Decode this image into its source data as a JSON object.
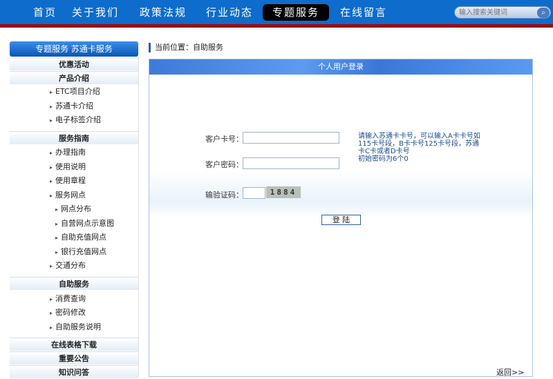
{
  "nav": [
    "首页",
    "关于我们",
    "政策法规",
    "行业动态",
    "专题服务",
    "在线留言"
  ],
  "search": {
    "placeholder": "输入搜索关键词",
    "button": "⌕"
  },
  "sidebar": {
    "title": "专题服务 苏通卡服务",
    "sections": [
      "优惠活动",
      "产品介绍",
      "服务指南",
      "自助服务",
      "在线表格下载",
      "重要公告",
      "知识问答"
    ],
    "product_items": [
      "ETC项目介绍",
      "苏通卡介绍",
      "电子标签介绍"
    ],
    "guide_items": [
      "办理指南",
      "使用说明",
      "使用章程",
      "服务网点"
    ],
    "outlet_items": [
      "网点分布",
      "自营网点示意图",
      "自助充值网点",
      "银行充值网点"
    ],
    "guide_last": "交通分布",
    "self_items": [
      "消费查询",
      "密码修改",
      "自助服务说明"
    ]
  },
  "breadcrumb": "当前位置：自助服务",
  "panel": {
    "title": "个人用户登录",
    "card_label": "客户卡号：",
    "password_label": "客户密码：",
    "captcha_label": "输验证码：",
    "captcha": "1884",
    "hint": "请输入苏通卡卡号，可以输入A卡卡号如115卡号段，B卡卡号125卡号段，苏通卡C卡或者D卡号",
    "hint2": "初始密码为6个0",
    "login": "登 陆",
    "back": "返回>>"
  }
}
